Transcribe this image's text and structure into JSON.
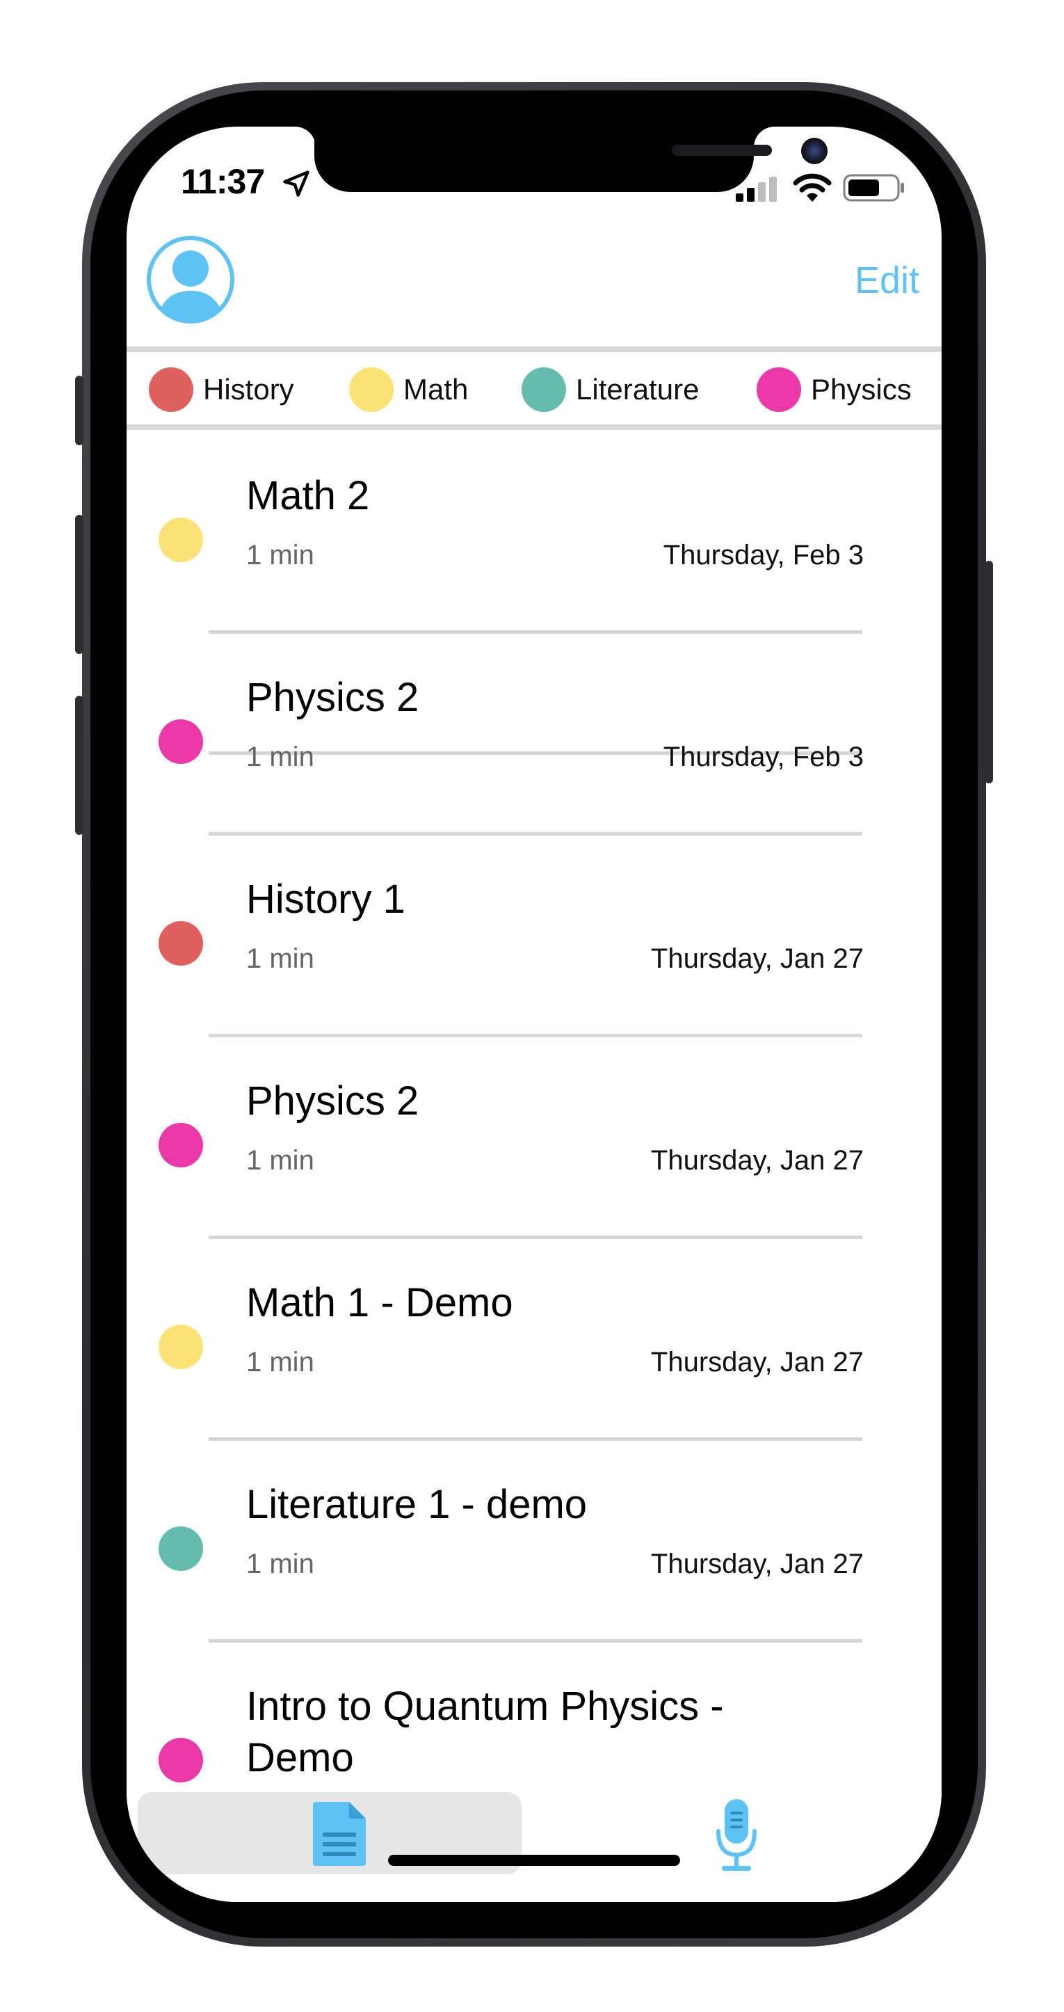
{
  "status_bar": {
    "time": "11:37",
    "icons": [
      "location-arrow-icon",
      "cellular-signal-icon",
      "wifi-icon",
      "battery-icon"
    ]
  },
  "header": {
    "avatar_icon": "person-circle-icon",
    "edit_label": "Edit"
  },
  "categories": [
    {
      "label": "History",
      "color": "#e0605e"
    },
    {
      "label": "Math",
      "color": "#fae374"
    },
    {
      "label": "Literature",
      "color": "#64bcae"
    },
    {
      "label": "Physics",
      "color": "#ea38a9"
    }
  ],
  "recordings": [
    {
      "title": "Math 2",
      "duration": "1 min",
      "date": "Thursday, Feb 3",
      "category": "Math",
      "color": "#fae374"
    },
    {
      "title": "Physics 2",
      "duration": "1 min",
      "date": "Thursday, Feb 3",
      "category": "Physics",
      "color": "#ea38a9"
    },
    {
      "title": "History 1",
      "duration": "1 min",
      "date": "Thursday, Jan 27",
      "category": "History",
      "color": "#e0605e"
    },
    {
      "title": "Physics 2",
      "duration": "1 min",
      "date": "Thursday, Jan 27",
      "category": "Physics",
      "color": "#ea38a9"
    },
    {
      "title": "Math 1 - Demo",
      "duration": "1 min",
      "date": "Thursday, Jan 27",
      "category": "Math",
      "color": "#fae374"
    },
    {
      "title": "Literature 1 - demo",
      "duration": "1 min",
      "date": "Thursday, Jan 27",
      "category": "Literature",
      "color": "#64bcae"
    },
    {
      "title": "Intro to Quantum Physics - Demo",
      "duration": "",
      "date": "",
      "category": "Physics",
      "color": "#ea38a9"
    }
  ],
  "tabbar": {
    "tabs": [
      {
        "icon": "document-icon",
        "selected": true
      },
      {
        "icon": "microphone-icon",
        "selected": false
      }
    ]
  },
  "colors": {
    "accent": "#5ec2f5",
    "divider": "#d6d6d6"
  }
}
